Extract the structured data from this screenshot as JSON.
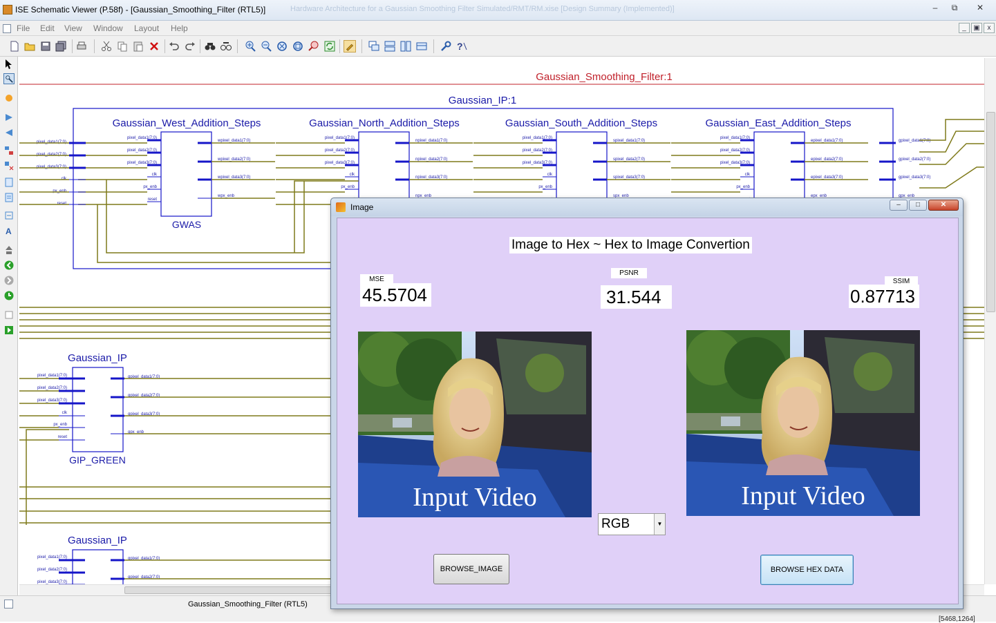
{
  "window": {
    "title": "ISE Schematic Viewer (P.58f) - [Gaussian_Smoothing_Filter (RTL5)]",
    "ghost_title": "Hardware Architecture for a Gaussian Smoothing Filter Simulated/RMT/RM.xise [Design Summary (Implemented)]"
  },
  "menu": [
    "File",
    "Edit",
    "View",
    "Window",
    "Layout",
    "Help"
  ],
  "schematic": {
    "top_title": "Gaussian_Smoothing_Filter:1",
    "ip_title": "Gaussian_IP:1",
    "blocks": [
      {
        "name": "Gaussian_West_Addition_Steps",
        "inst": "GWAS",
        "inputs": [
          "pixel_data1(7:0)",
          "pixel_data2(7:0)",
          "pixel_data3(7:0)",
          "clk",
          "px_enb",
          "reset"
        ],
        "outputs": [
          "wpixel_data1(7:0)",
          "wpixel_data2(7:0)",
          "wpixel_data3(7:0)",
          "wpx_enb"
        ]
      },
      {
        "name": "Gaussian_North_Addition_Steps",
        "inst": "",
        "inputs": [
          "pixel_data1(7:0)",
          "pixel_data2(7:0)",
          "pixel_data3(7:0)",
          "clk",
          "px_enb",
          "reset"
        ],
        "outputs": [
          "npixel_data1(7:0)",
          "npixel_data2(7:0)",
          "npixel_data3(7:0)",
          "npx_enb"
        ]
      },
      {
        "name": "Gaussian_South_Addition_Steps",
        "inst": "",
        "inputs": [
          "pixel_data1(7:0)",
          "pixel_data2(7:0)",
          "pixel_data3(7:0)",
          "clk",
          "px_enb",
          "reset"
        ],
        "outputs": [
          "spixel_data1(7:0)",
          "spixel_data2(7:0)",
          "spixel_data3(7:0)",
          "spx_enb"
        ]
      },
      {
        "name": "Gaussian_East_Addition_Steps",
        "inst": "",
        "inputs": [
          "pixel_data1(7:0)",
          "pixel_data2(7:0)",
          "pixel_data3(7:0)",
          "clk",
          "px_enb",
          "reset"
        ],
        "outputs": [
          "epixel_data1(7:0)",
          "epixel_data2(7:0)",
          "epixel_data3(7:0)",
          "epx_enb"
        ]
      }
    ],
    "ip_outputs": [
      "gpixel_data1(7:0)",
      "gpixel_data2(7:0)",
      "gpixel_data3(7:0)",
      "gpx_enb"
    ],
    "gip_green": {
      "name": "Gaussian_IP",
      "inst": "GIP_GREEN",
      "inputs": [
        "pixel_data1(7:0)",
        "pixel_data2(7:0)",
        "pixel_data3(7:0)",
        "clk",
        "px_enb",
        "reset"
      ],
      "outputs": [
        "gpixel_data1(7:0)",
        "gpixel_data2(7:0)",
        "gpixel_data3(7:0)",
        "gpx_enb"
      ]
    },
    "gip_third": {
      "name": "Gaussian_IP",
      "inputs": [
        "pixel_data1(7:0)",
        "pixel_data2(7:0)",
        "pixel_data3(7:0)"
      ],
      "outputs": [
        "gpixel_data1(7:0)",
        "gpixel_data2(7:0)"
      ]
    }
  },
  "status": {
    "tab_label": "Gaussian_Smoothing_Filter (RTL5)",
    "coords": "[5468,1264]"
  },
  "dialog": {
    "title": "Image",
    "heading": "Image to Hex ~ Hex to Image Convertion",
    "mse": {
      "label": "MSE",
      "value": "45.5704"
    },
    "psnr": {
      "label": "PSNR",
      "value": "31.544"
    },
    "ssim": {
      "label": "SSIM",
      "value": "0.87713"
    },
    "left_image_caption": "Input Video",
    "right_image_caption": "Input Video",
    "color_mode": "RGB",
    "browse_image_label": "BROWSE_IMAGE",
    "browse_hex_label": "BROWSE HEX DATA"
  },
  "colors": {
    "wire": "#7f7a1a",
    "block": "#1515c8",
    "label_blue": "#1a1aa8",
    "title_red": "#c0202a",
    "dialog_bg": "#e0d0f8"
  },
  "icons": [
    "new-file-icon",
    "open-folder-icon",
    "save-icon",
    "save-all-icon",
    "print-icon",
    "cut-icon",
    "copy-icon",
    "paste-icon",
    "delete-icon",
    "undo-icon",
    "redo-icon",
    "find-icon",
    "find-next-icon",
    "zoom-in-icon",
    "zoom-out-icon",
    "zoom-full-icon",
    "zoom-area-icon",
    "zoom-selected-icon",
    "refresh-icon",
    "pan-icon",
    "cascade-icon",
    "tile-horizontal-icon",
    "tile-vertical-icon",
    "arrange-icon",
    "properties-icon",
    "help-icon"
  ]
}
